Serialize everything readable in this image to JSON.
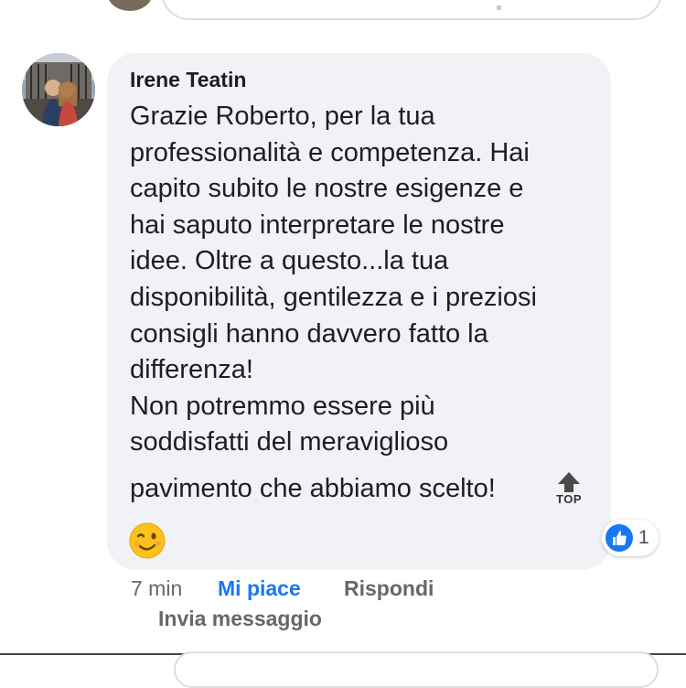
{
  "comment": {
    "author": "Irene Teatin",
    "text": "Grazie Roberto, per la tua\nprofessionalità e competenza. Hai\ncapito subito le nostre esigenze e\nhai saputo interpretare le nostre\nidee. Oltre a questo...la tua\ndisponibilità, gentilezza e i preziosi\nconsigli hanno davvero fatto la\ndifferenza!\nNon potremmo essere più\nsoddisfatti del meraviglioso",
    "last_line": "pavimento che abbiamo scelto!",
    "top_label": "TOP",
    "emoji": "winking-face-emoji",
    "reaction_icon": "like-icon",
    "reaction_count": "1",
    "time": "7 min",
    "like_label": "Mi piace",
    "reply_label": "Rispondi",
    "message_label": "Invia messaggio"
  },
  "colors": {
    "bubble": "#f0f2f5",
    "like_blue": "#1877f2",
    "secondary_text": "#65676b"
  }
}
